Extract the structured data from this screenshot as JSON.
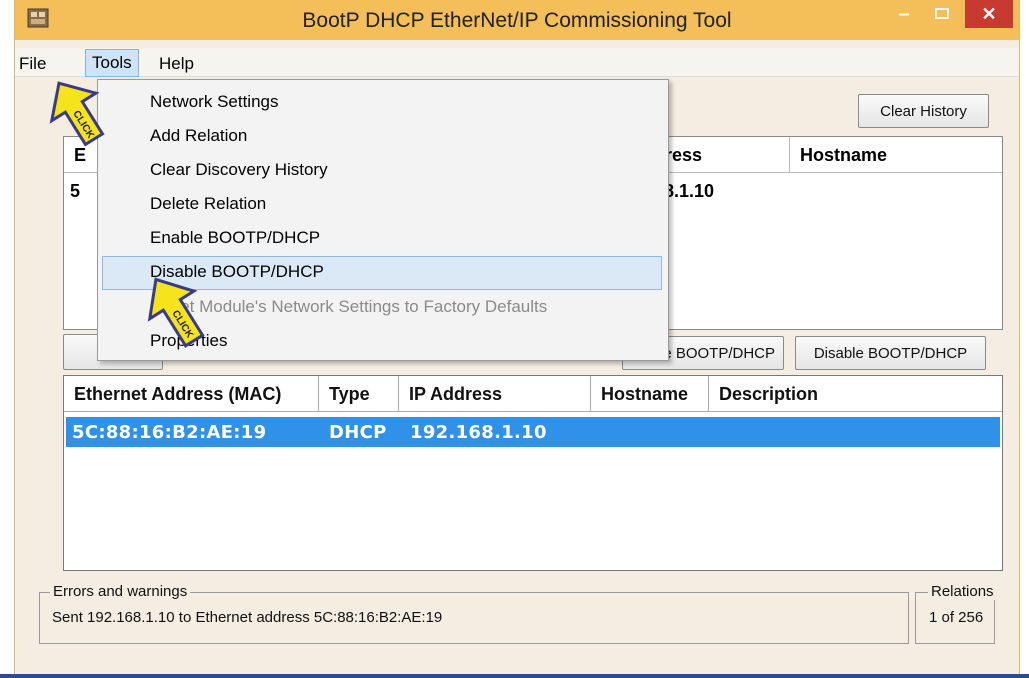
{
  "window": {
    "title": "BootP DHCP EtherNet/IP Commissioning Tool",
    "close_glyph": "✕",
    "minimize_glyph": "–"
  },
  "menubar": {
    "file": "File",
    "tools": "Tools",
    "help": "Help"
  },
  "toolbar": {
    "clear_history": "Clear History"
  },
  "discovery_list": {
    "headers": [
      "E",
      "dress",
      "Hostname"
    ],
    "row": {
      "mac_partial": "5",
      "ip_partial": "68.1.10"
    }
  },
  "buttons": {
    "enable_partial": "e BOOTP/DHCP",
    "disable": "Disable BOOTP/DHCP"
  },
  "relation_list": {
    "headers": [
      "Ethernet Address (MAC)",
      "Type",
      "IP Address",
      "Hostname",
      "Description"
    ],
    "rows": [
      {
        "mac": "5C:88:16:B2:AE:19",
        "type": "DHCP",
        "ip": "192.168.1.10",
        "hostname": "",
        "description": ""
      }
    ]
  },
  "status": {
    "errors_label": "Errors and warnings",
    "errors_text": "Sent 192.168.1.10 to Ethernet address 5C:88:16:B2:AE:19",
    "relations_label": "Relations",
    "relations_text": "1 of 256"
  },
  "tools_menu": {
    "items": [
      {
        "label": "Network Settings",
        "enabled": true
      },
      {
        "label": "Add Relation",
        "enabled": true
      },
      {
        "label": "Clear Discovery History",
        "enabled": true
      },
      {
        "label": "Delete Relation",
        "enabled": true
      },
      {
        "label": "Enable BOOTP/DHCP",
        "enabled": true
      },
      {
        "label": "Disable BOOTP/DHCP",
        "enabled": true,
        "highlighted": true
      },
      {
        "label": "Reset Module's Network Settings to Factory Defaults",
        "enabled": false
      },
      {
        "label": "Properties",
        "enabled": true
      }
    ]
  },
  "annotations": {
    "click_label": "CLICK",
    "cursor_color": "#f5e419"
  },
  "colors": {
    "titlebar": "#f4be59",
    "close_button": "#c63a2f",
    "selection": "#2f91e8",
    "menu_highlight": "#dbe8f5"
  }
}
